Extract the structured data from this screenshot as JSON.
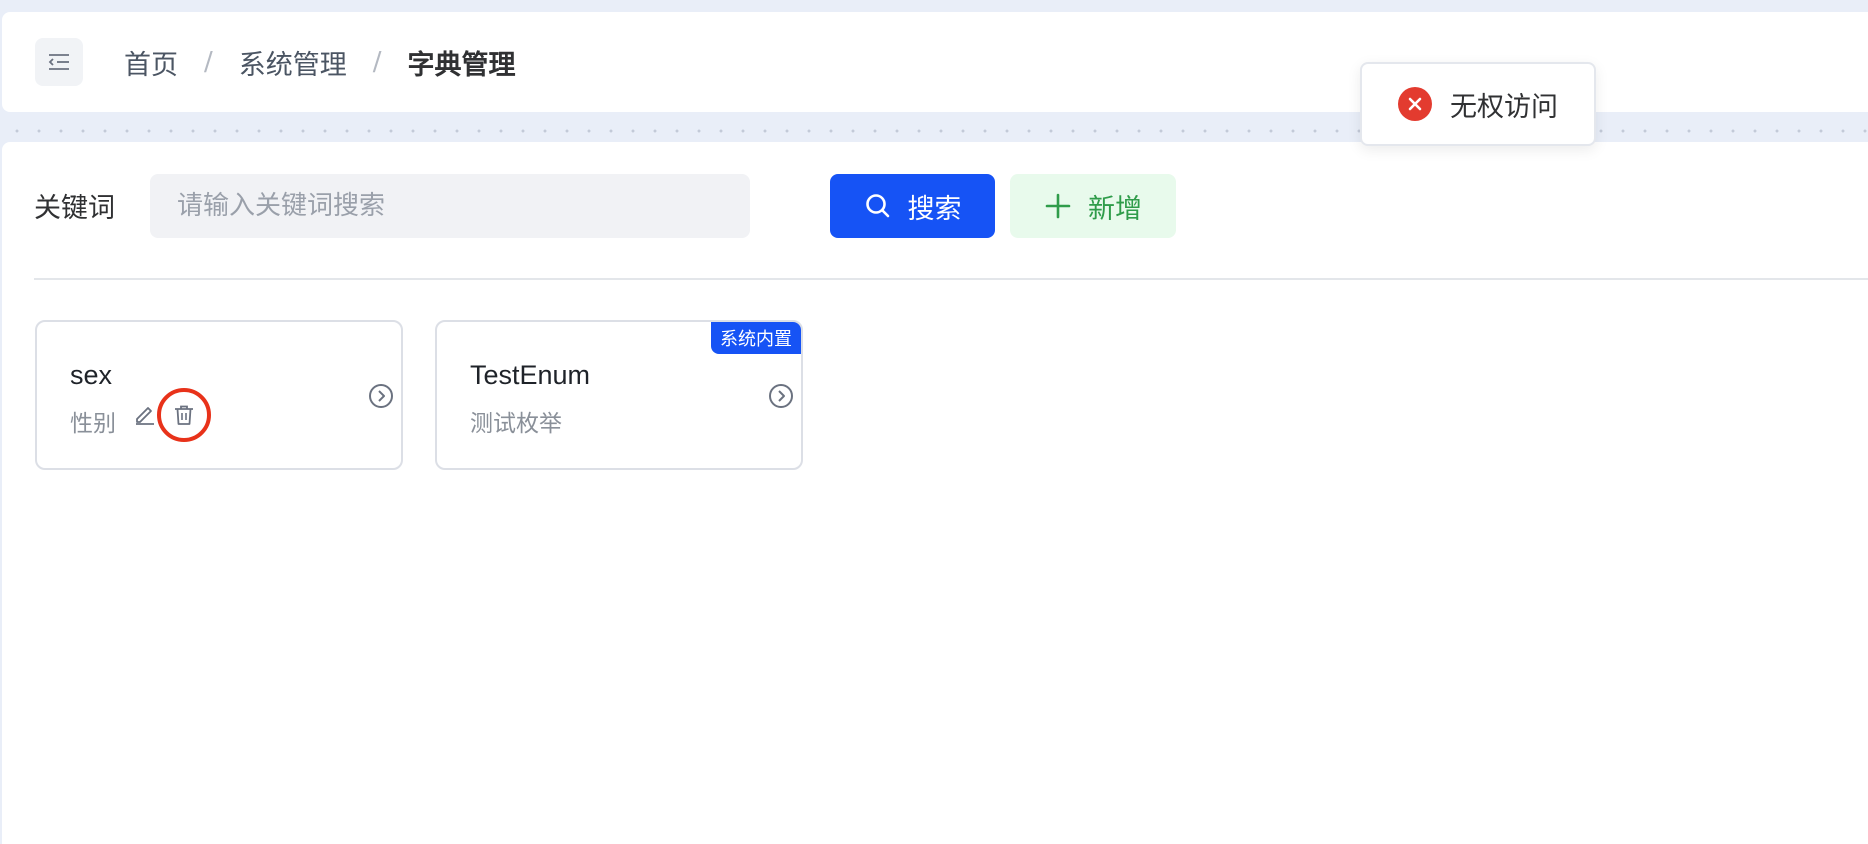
{
  "header": {
    "breadcrumb": [
      "首页",
      "系统管理",
      "字典管理"
    ]
  },
  "toast": {
    "message": "无权访问",
    "type": "error"
  },
  "search": {
    "label": "关键词",
    "placeholder": "请输入关键词搜索",
    "value": "",
    "search_button": "搜索",
    "add_button": "新增"
  },
  "cards": [
    {
      "name": "sex",
      "label": "性别",
      "builtin": false,
      "actions": [
        "edit-icon",
        "delete-icon"
      ]
    },
    {
      "name": "TestEnum",
      "label": "测试枚举",
      "builtin": true,
      "badge": "系统内置"
    }
  ],
  "colors": {
    "primary": "#1653f5",
    "success_text": "#2f9c4a",
    "success_bg": "#e8faec",
    "error": "#e33b2f",
    "highlight_ring": "#e8321a",
    "page_bg": "#e9eef8"
  },
  "icons": {
    "collapse": "indent-icon",
    "search": "search-icon",
    "add": "plus-icon",
    "card_arrow": "chevron-right-circle-icon",
    "toast": "error-circle-icon"
  }
}
